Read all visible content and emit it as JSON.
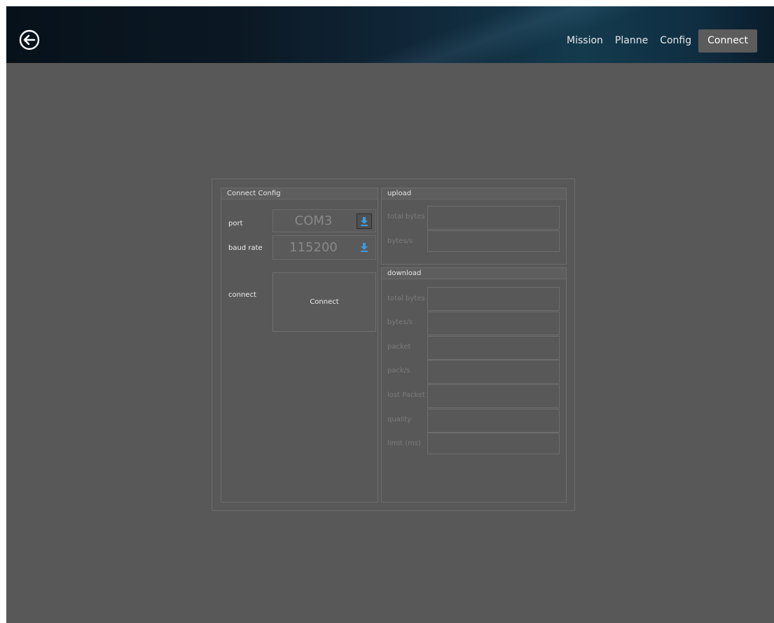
{
  "nav": {
    "items": [
      "Mission",
      "Planne",
      "Config",
      "Connect"
    ],
    "active": "Connect"
  },
  "icons": {
    "back": "back-arrow-circle-icon",
    "download": "download-arrow-icon"
  },
  "colors": {
    "accent_blue": "#3b9ae1",
    "background": "#585858",
    "topbar": "#0b1824"
  },
  "connect_config": {
    "title": "Connect Config",
    "port_label": "port",
    "port_value": "COM3",
    "baud_label": "baud rate",
    "baud_value": "115200",
    "connect_label": "connect",
    "connect_button": "Connect"
  },
  "upload": {
    "title": "upload",
    "rows": [
      {
        "label": "total bytes",
        "value": ""
      },
      {
        "label": "bytes/s",
        "value": ""
      }
    ]
  },
  "download": {
    "title": "download",
    "rows": [
      {
        "label": "total bytes",
        "value": ""
      },
      {
        "label": "bytes/s",
        "value": ""
      },
      {
        "label": "packet",
        "value": ""
      },
      {
        "label": "pack/s",
        "value": ""
      },
      {
        "label": "lost Packet",
        "value": ""
      },
      {
        "label": "quality",
        "value": ""
      },
      {
        "label": "limit (ms)",
        "value": ""
      }
    ]
  }
}
